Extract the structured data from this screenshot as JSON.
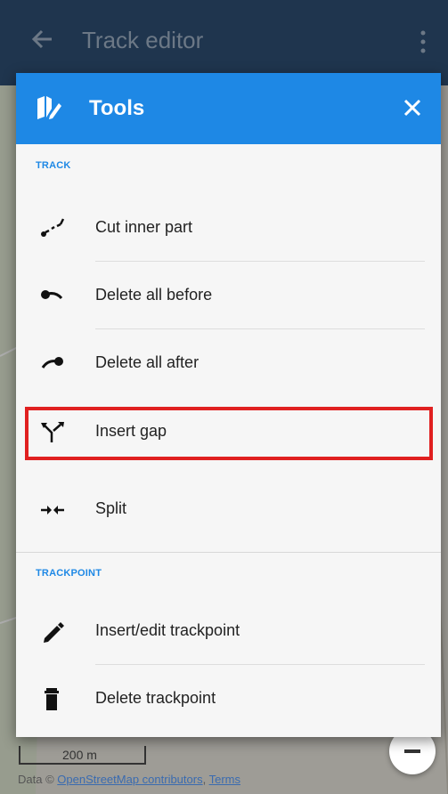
{
  "app_bar": {
    "title": "Track editor",
    "back_icon": "arrow-back-icon",
    "menu_icon": "more-vert-icon"
  },
  "dialog": {
    "title": "Tools",
    "header_icon": "map-tools-icon",
    "close_icon": "close-icon",
    "accent_color": "#1e88e5",
    "sections": [
      {
        "label": "TRACK",
        "items": [
          {
            "label": "Cut inner part",
            "icon": "cut-inner-part-icon"
          },
          {
            "label": "Delete all before",
            "icon": "delete-before-icon"
          },
          {
            "label": "Delete all after",
            "icon": "delete-after-icon"
          },
          {
            "label": "Insert gap",
            "icon": "insert-gap-icon",
            "highlighted": true
          },
          {
            "label": "Split",
            "icon": "split-icon"
          }
        ]
      },
      {
        "label": "TRACKPOINT",
        "items": [
          {
            "label": "Insert/edit trackpoint",
            "icon": "pencil-icon"
          },
          {
            "label": "Delete trackpoint",
            "icon": "trash-icon"
          }
        ]
      }
    ]
  },
  "map": {
    "scale_label": "200 m",
    "attribution_prefix": "Data ©",
    "attribution_link": "OpenStreetMap contributors",
    "attribution_sep": ",",
    "attribution_terms": "Terms",
    "zoom_out_icon": "minus-icon"
  },
  "colors": {
    "app_bar": "#2f4f73",
    "highlight": "#e02020"
  }
}
